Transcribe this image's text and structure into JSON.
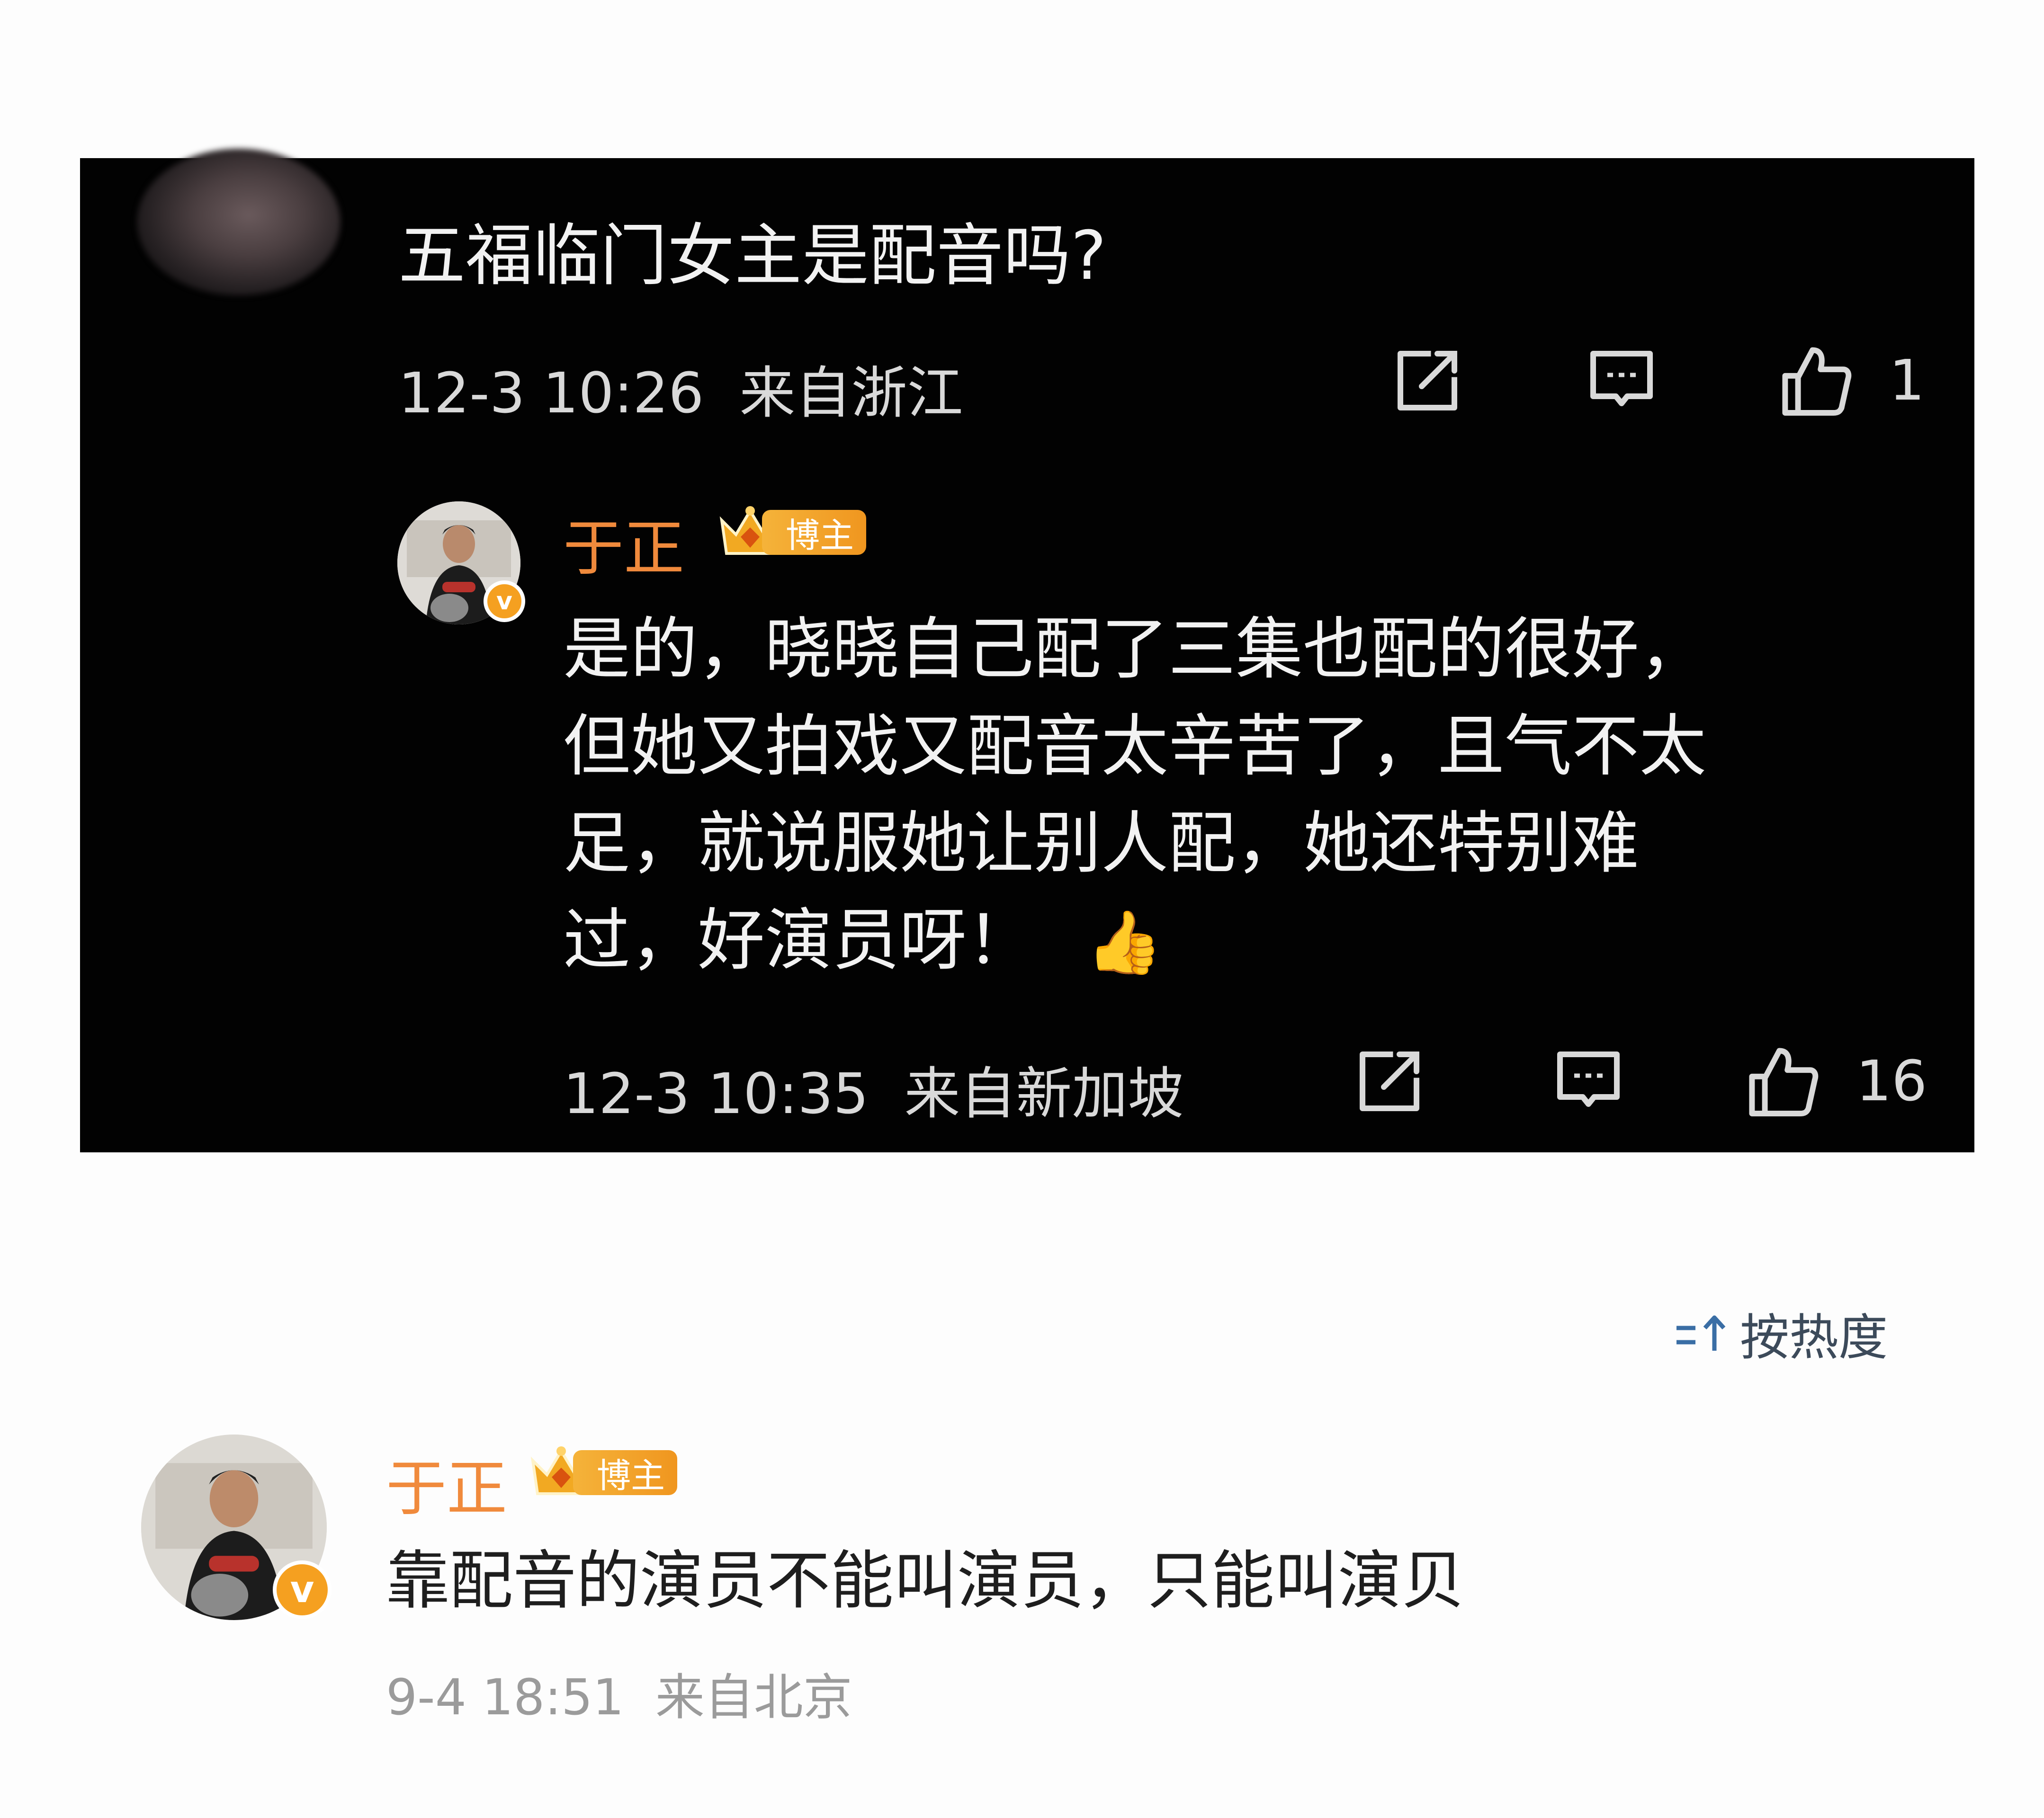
{
  "question": {
    "text": "五福临门女主是配音吗?",
    "time": "12-3 10:26",
    "location": "来自浙江",
    "likes": "1"
  },
  "reply": {
    "username": "于正",
    "badge": "博主",
    "lines": [
      "是的，晓晓自己配了三集也配的很好，",
      "但她又拍戏又配音太辛苦了，且气不太",
      "足，就说服她让别人配，她还特别难",
      "过，好演员呀！"
    ],
    "emoji": "👍",
    "time": "12-3 10:35",
    "location": "来自新加坡",
    "likes": "16"
  },
  "sort": {
    "label": "按热度"
  },
  "comment": {
    "username": "于正",
    "badge": "博主",
    "text": "靠配音的演员不能叫演员，只能叫演贝",
    "time": "9-4 18:51",
    "location": "来自北京"
  },
  "colors": {
    "panel_bg": "#020202",
    "username": "#f08a3c",
    "badge_bg": "#f5a020",
    "sort_icon": "#3a6ea5"
  },
  "icons": [
    "share-icon",
    "comment-icon",
    "like-icon",
    "verified-v-icon",
    "crown-icon",
    "sort-icon",
    "thumbs-up-emoji"
  ]
}
